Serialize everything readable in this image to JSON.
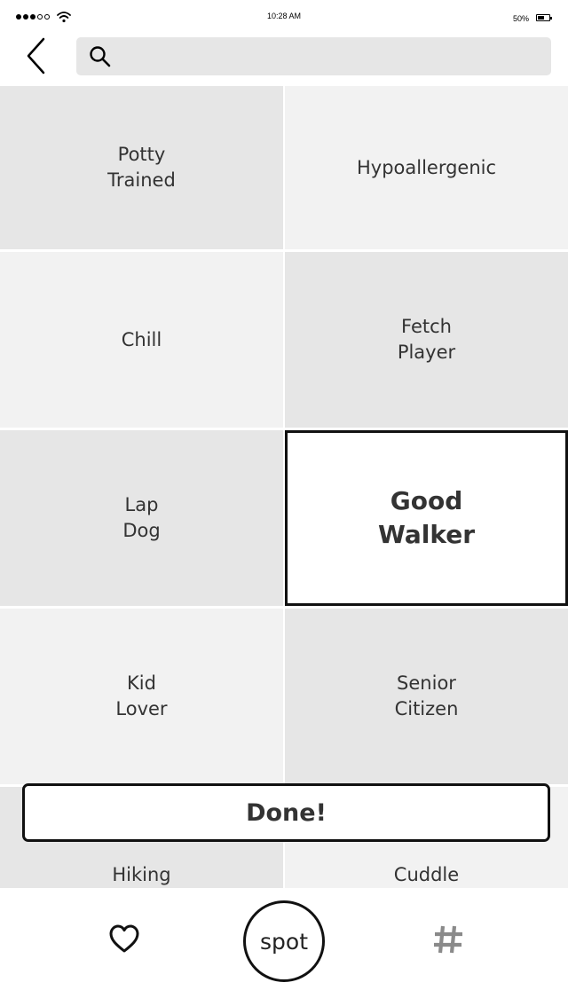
{
  "status_bar": {
    "time": "10:28 AM",
    "battery_percent": "50%",
    "battery_level": 0.5,
    "signal_bars_filled": 3,
    "signal_bars_total": 5
  },
  "search": {
    "value": "",
    "placeholder": ""
  },
  "tiles": [
    {
      "label": "Potty\nTrained",
      "shade": "dark",
      "selected": false
    },
    {
      "label": "Hypoallergenic",
      "shade": "light",
      "selected": false
    },
    {
      "label": "Chill",
      "shade": "light",
      "selected": false
    },
    {
      "label": "Fetch\nPlayer",
      "shade": "dark",
      "selected": false
    },
    {
      "label": "Lap\nDog",
      "shade": "dark",
      "selected": false
    },
    {
      "label": "Good\nWalker",
      "shade": "light",
      "selected": true
    },
    {
      "label": "Kid\nLover",
      "shade": "light",
      "selected": false
    },
    {
      "label": "Senior\nCitizen",
      "shade": "dark",
      "selected": false
    },
    {
      "label": "Hiking\nCompanion",
      "shade": "dark",
      "selected": false
    },
    {
      "label": "Cuddle\nBuddy",
      "shade": "light",
      "selected": false
    }
  ],
  "done_label": "Done!",
  "tab_bar": {
    "favorites_icon": "heart-icon",
    "center_label": "spot",
    "tags_icon": "hashtag-icon"
  },
  "colors": {
    "tile_dark": "#e6e6e6",
    "tile_light": "#f2f2f2",
    "selected_border": "#111111",
    "text": "#333333"
  }
}
